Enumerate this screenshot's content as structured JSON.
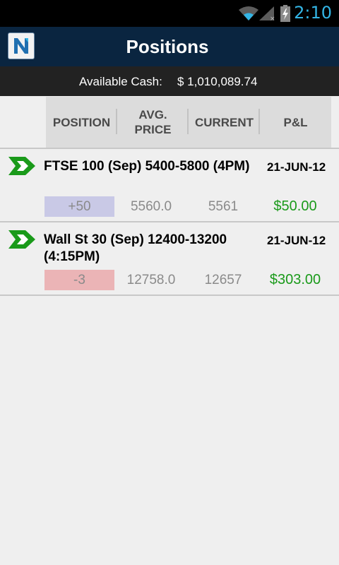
{
  "status_bar": {
    "time": "2:10",
    "icons": [
      "wifi-icon",
      "signal-icon",
      "battery-charging-icon"
    ]
  },
  "action_bar": {
    "title": "Positions",
    "logo_letter": "N"
  },
  "cash": {
    "label": "Available Cash:",
    "value": "$ 1,010,089.74"
  },
  "columns": [
    "POSITION",
    "AVG.\nPRICE",
    "CURRENT",
    "P&L"
  ],
  "colors": {
    "profit": "#1a9a1a",
    "long_bg": "#c9c9e6",
    "short_bg": "#ebb4b6",
    "accent": "#33b5e5",
    "header_bg": "#0a2540"
  },
  "positions": [
    {
      "instrument": "FTSE 100 (Sep) 5400-5800 (4PM)",
      "date": "21-JUN-12",
      "position": "+50",
      "avg_price": "5560.0",
      "current": "5561",
      "pnl": "$50.00",
      "direction": "long"
    },
    {
      "instrument": "Wall St 30 (Sep) 12400-13200 (4:15PM)",
      "date": "21-JUN-12",
      "position": "-3",
      "avg_price": "12758.0",
      "current": "12657",
      "pnl": "$303.00",
      "direction": "short"
    }
  ]
}
